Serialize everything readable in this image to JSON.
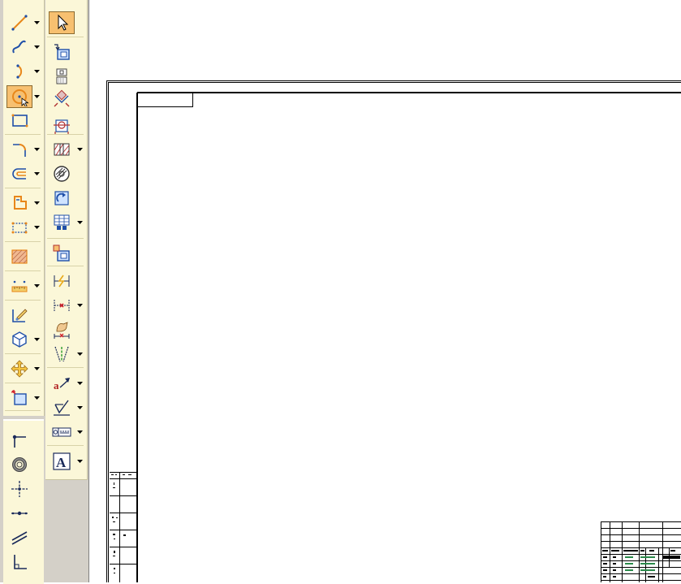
{
  "left_toolbar": {
    "tools": [
      {
        "name": "line-tool",
        "icon": "line-icon",
        "has_dropdown": true
      },
      {
        "name": "curve-tool",
        "icon": "spline-icon",
        "has_dropdown": true
      },
      {
        "name": "arc-tool",
        "icon": "arc-icon",
        "has_dropdown": true
      },
      {
        "name": "circle-tool",
        "icon": "circle-icon",
        "has_dropdown": true,
        "active": true
      },
      {
        "name": "rectangle-tool",
        "icon": "rectangle-icon",
        "has_dropdown": false
      },
      {
        "name": "fillet-tool",
        "icon": "fillet-icon",
        "has_dropdown": true
      },
      {
        "name": "offset-tool",
        "icon": "offset-icon",
        "has_dropdown": true
      },
      {
        "name": "polygon-tool",
        "icon": "polygon-icon",
        "has_dropdown": true
      },
      {
        "name": "pattern-tool",
        "icon": "pattern-icon",
        "has_dropdown": true
      },
      {
        "name": "hatch-tool",
        "icon": "hatch-icon",
        "has_dropdown": false
      },
      {
        "name": "ruler-tool",
        "icon": "ruler-icon",
        "has_dropdown": true
      },
      {
        "name": "paint-tool",
        "icon": "paintbrush-icon",
        "has_dropdown": false
      },
      {
        "name": "view-3d-tool",
        "icon": "cube-icon",
        "has_dropdown": true
      },
      {
        "name": "move-tool",
        "icon": "move-arrows-icon",
        "has_dropdown": true
      },
      {
        "name": "frame-tool",
        "icon": "frame-icon",
        "has_dropdown": true
      }
    ],
    "lower_tools": [
      {
        "name": "centerline-tool",
        "icon": "centerline-icon"
      },
      {
        "name": "bolt-circle-tool",
        "icon": "ring-icon"
      },
      {
        "name": "center-mark-tool",
        "icon": "center-mark-icon"
      },
      {
        "name": "axis-tool",
        "icon": "axis-icon"
      },
      {
        "name": "parallel-lines-tool",
        "icon": "parallel-lines-icon"
      },
      {
        "name": "perpendicular-tool",
        "icon": "perpendicular-icon"
      }
    ]
  },
  "right_toolbar": {
    "tools": [
      {
        "name": "select-tool",
        "icon": "cursor-arrow-icon",
        "has_dropdown": false,
        "active": true
      },
      {
        "name": "view-base-tool",
        "icon": "base-view-icon",
        "has_dropdown": false
      },
      {
        "name": "view-projection-tool",
        "icon": "projection-view-icon",
        "has_dropdown": false
      },
      {
        "name": "auxiliary-view-tool",
        "icon": "auxiliary-view-icon",
        "has_dropdown": false
      },
      {
        "name": "section-view-tool",
        "icon": "section-view-icon",
        "has_dropdown": false
      },
      {
        "name": "break-view-tool",
        "icon": "break-view-icon",
        "has_dropdown": true
      },
      {
        "name": "detail-view-tool",
        "icon": "detail-view-icon",
        "has_dropdown": false
      },
      {
        "name": "rotate-view-tool",
        "icon": "rotate-view-icon",
        "has_dropdown": false
      },
      {
        "name": "table-tool",
        "icon": "table-icon",
        "has_dropdown": true
      },
      {
        "name": "layout-view-tool",
        "icon": "layout-view-icon",
        "has_dropdown": false
      },
      {
        "name": "smart-dimension-tool",
        "icon": "smart-dimension-icon",
        "has_dropdown": false
      },
      {
        "name": "linear-dimension-tool",
        "icon": "linear-dimension-icon",
        "has_dropdown": true
      },
      {
        "name": "retrieve-dimension-tool",
        "icon": "retrieve-dimension-icon",
        "has_dropdown": false
      },
      {
        "name": "angle-dimension-tool",
        "icon": "angle-dimension-icon",
        "has_dropdown": true
      },
      {
        "name": "callout-tool",
        "icon": "callout-icon",
        "has_dropdown": true
      },
      {
        "name": "surface-texture-tool",
        "icon": "surface-texture-icon",
        "has_dropdown": true
      },
      {
        "name": "feature-control-frame-tool",
        "icon": "feature-control-icon",
        "has_dropdown": true
      },
      {
        "name": "text-tool",
        "icon": "text-a-icon",
        "has_dropdown": true
      }
    ]
  },
  "drawing": {
    "colors": {
      "toolbar_bg": "#fbf7d8",
      "active_bg": "#f7c070",
      "icon_orange": "#e8871a",
      "icon_blue": "#1f4fa8",
      "canvas_bg": "#ffffff",
      "line": "#000000"
    }
  }
}
